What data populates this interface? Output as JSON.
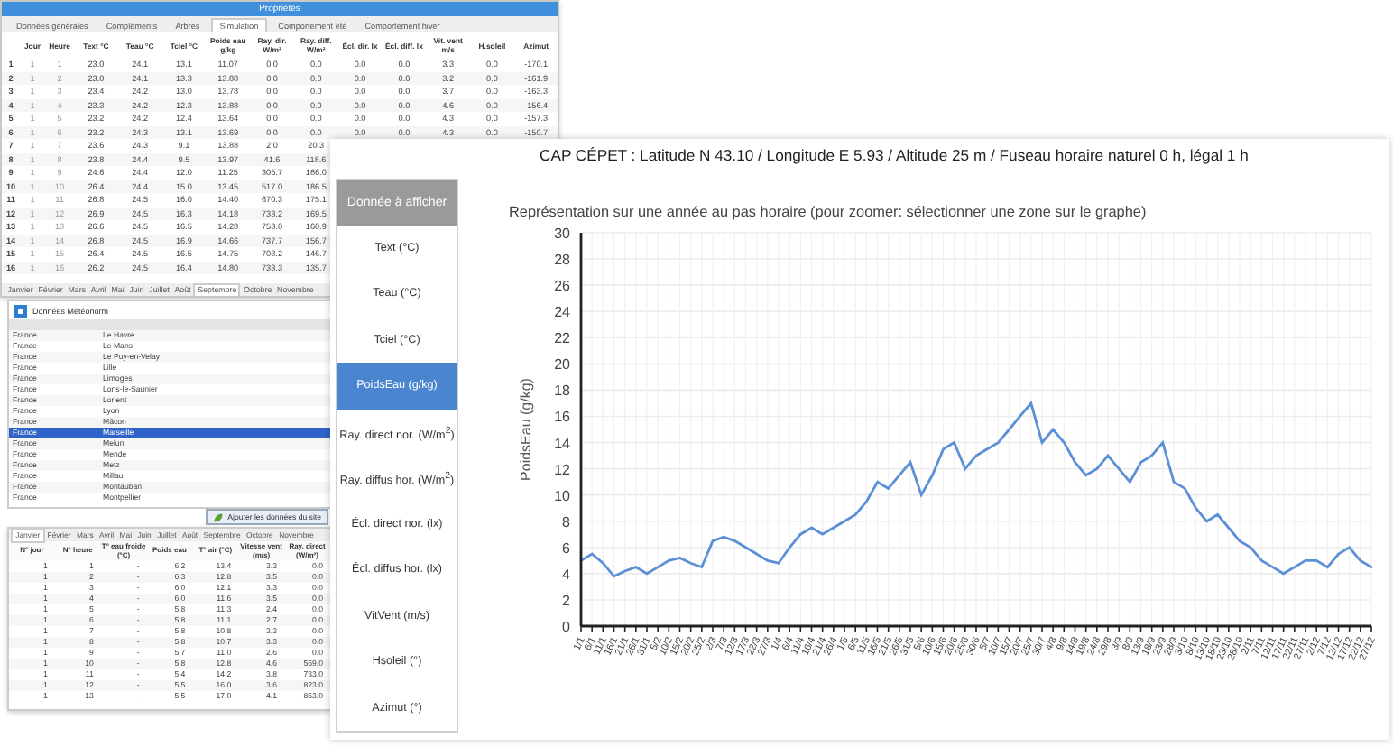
{
  "properties_window": {
    "title": "Propriétés",
    "tabs": [
      {
        "label": "Données générales",
        "selected": false
      },
      {
        "label": "Compléments",
        "selected": false
      },
      {
        "label": "Arbres",
        "selected": false
      },
      {
        "label": "Simulation",
        "selected": true
      },
      {
        "label": "Comportement été",
        "selected": false
      },
      {
        "label": "Comportement hiver",
        "selected": false
      }
    ],
    "table": {
      "columns": [
        "",
        "Jour",
        "Heure",
        "Text °C",
        "Teau °C",
        "Tciel °C",
        "Poids eau g/kg",
        "Ray. dir. W/m²",
        "Ray. diff. W/m²",
        "Écl. dir. lx",
        "Écl. diff. lx",
        "Vit. vent m/s",
        "H.soleil",
        "Azimut"
      ],
      "rows": [
        [
          "1",
          "1",
          "1",
          "23.0",
          "24.1",
          "13.1",
          "11.07",
          "0.0",
          "0.0",
          "0.0",
          "0.0",
          "3.3",
          "0.0",
          "-170.1"
        ],
        [
          "2",
          "1",
          "2",
          "23.0",
          "24.1",
          "13.3",
          "13.88",
          "0.0",
          "0.0",
          "0.0",
          "0.0",
          "3.2",
          "0.0",
          "-161.9"
        ],
        [
          "3",
          "1",
          "3",
          "23.4",
          "24.2",
          "13.0",
          "13.78",
          "0.0",
          "0.0",
          "0.0",
          "0.0",
          "3.7",
          "0.0",
          "-163.3"
        ],
        [
          "4",
          "1",
          "4",
          "23.3",
          "24.2",
          "12.3",
          "13.88",
          "0.0",
          "0.0",
          "0.0",
          "0.0",
          "4.6",
          "0.0",
          "-156.4"
        ],
        [
          "5",
          "1",
          "5",
          "23.2",
          "24.2",
          "12.4",
          "13.64",
          "0.0",
          "0.0",
          "0.0",
          "0.0",
          "4.3",
          "0.0",
          "-157.3"
        ],
        [
          "6",
          "1",
          "6",
          "23.2",
          "24.3",
          "13.1",
          "13.69",
          "0.0",
          "0.0",
          "0.0",
          "0.0",
          "4.3",
          "0.0",
          "-150.7"
        ],
        [
          "7",
          "1",
          "7",
          "23.6",
          "24.3",
          "9.1",
          "13.88",
          "2.0",
          "20.3"
        ],
        [
          "8",
          "1",
          "8",
          "23.8",
          "24.4",
          "9.5",
          "13.97",
          "41.6",
          "118.6"
        ],
        [
          "9",
          "1",
          "9",
          "24.6",
          "24.4",
          "12.0",
          "11.25",
          "305.7",
          "186.0"
        ],
        [
          "10",
          "1",
          "10",
          "26.4",
          "24.4",
          "15.0",
          "13.45",
          "517.0",
          "186.5"
        ],
        [
          "11",
          "1",
          "11",
          "26.8",
          "24.5",
          "16.0",
          "14.40",
          "670.3",
          "175.1"
        ],
        [
          "12",
          "1",
          "12",
          "26.9",
          "24.5",
          "16.3",
          "14.18",
          "733.2",
          "169.5"
        ],
        [
          "13",
          "1",
          "13",
          "26.6",
          "24.5",
          "16.5",
          "14.28",
          "753.0",
          "160.9"
        ],
        [
          "14",
          "1",
          "14",
          "26.8",
          "24.5",
          "16.9",
          "14.66",
          "737.7",
          "156.7"
        ],
        [
          "15",
          "1",
          "15",
          "26.4",
          "24.5",
          "16.5",
          "14.75",
          "703.2",
          "146.7"
        ],
        [
          "16",
          "1",
          "16",
          "26.2",
          "24.5",
          "16.4",
          "14.80",
          "733.3",
          "135.7"
        ]
      ]
    },
    "months": [
      {
        "label": "Janvier",
        "selected": false
      },
      {
        "label": "Février",
        "selected": false
      },
      {
        "label": "Mars",
        "selected": false
      },
      {
        "label": "Avril",
        "selected": false
      },
      {
        "label": "Mai",
        "selected": false
      },
      {
        "label": "Juin",
        "selected": false
      },
      {
        "label": "Juillet",
        "selected": false
      },
      {
        "label": "Août",
        "selected": false
      },
      {
        "label": "Septembre",
        "selected": true
      },
      {
        "label": "Octobre",
        "selected": false
      },
      {
        "label": "Novembre",
        "selected": false
      }
    ]
  },
  "meteonorm_window": {
    "title": "Données Météonorm",
    "stations": [
      {
        "country": "France",
        "city": "Le Havre",
        "selected": false
      },
      {
        "country": "France",
        "city": "Le Mans",
        "selected": false
      },
      {
        "country": "France",
        "city": "Le Puy-en-Velay",
        "selected": false
      },
      {
        "country": "France",
        "city": "Lille",
        "selected": false
      },
      {
        "country": "France",
        "city": "Limoges",
        "selected": false
      },
      {
        "country": "France",
        "city": "Lons-le-Saunier",
        "selected": false
      },
      {
        "country": "France",
        "city": "Lorient",
        "selected": false
      },
      {
        "country": "France",
        "city": "Lyon",
        "selected": false
      },
      {
        "country": "France",
        "city": "Mâcon",
        "selected": false
      },
      {
        "country": "France",
        "city": "Marseille",
        "selected": true
      },
      {
        "country": "France",
        "city": "Melun",
        "selected": false
      },
      {
        "country": "France",
        "city": "Mende",
        "selected": false
      },
      {
        "country": "France",
        "city": "Metz",
        "selected": false
      },
      {
        "country": "France",
        "city": "Millau",
        "selected": false
      },
      {
        "country": "France",
        "city": "Montauban",
        "selected": false
      },
      {
        "country": "France",
        "city": "Montpellier",
        "selected": false
      }
    ],
    "button": "Ajouter les données du site"
  },
  "hourly_window": {
    "months": [
      {
        "label": "Janvier",
        "selected": true
      },
      {
        "label": "Février",
        "selected": false
      },
      {
        "label": "Mars",
        "selected": false
      },
      {
        "label": "Avril",
        "selected": false
      },
      {
        "label": "Mai",
        "selected": false
      },
      {
        "label": "Juin",
        "selected": false
      },
      {
        "label": "Juillet",
        "selected": false
      },
      {
        "label": "Août",
        "selected": false
      },
      {
        "label": "Septembre",
        "selected": false
      },
      {
        "label": "Octobre",
        "selected": false
      },
      {
        "label": "Novembre",
        "selected": false
      }
    ],
    "columns": [
      "N° jour",
      "N° heure",
      "T° eau froide (°C)",
      "Poids eau",
      "T° air (°C)",
      "Vitesse vent (m/s)",
      "Ray. direct (W/m²)"
    ],
    "rows": [
      [
        "1",
        "1",
        "-",
        "6.2",
        "13.4",
        "3.3",
        "0.0"
      ],
      [
        "1",
        "2",
        "-",
        "6.3",
        "12.8",
        "3.5",
        "0.0"
      ],
      [
        "1",
        "3",
        "-",
        "6.0",
        "12.1",
        "3.3",
        "0.0"
      ],
      [
        "1",
        "4",
        "-",
        "6.0",
        "11.6",
        "3.5",
        "0.0"
      ],
      [
        "1",
        "5",
        "-",
        "5.8",
        "11.3",
        "2.4",
        "0.0"
      ],
      [
        "1",
        "6",
        "-",
        "5.8",
        "11.1",
        "2.7",
        "0.0"
      ],
      [
        "1",
        "7",
        "-",
        "5.8",
        "10.8",
        "3.3",
        "0.0"
      ],
      [
        "1",
        "8",
        "-",
        "5.8",
        "10.7",
        "3.3",
        "0.0"
      ],
      [
        "1",
        "9",
        "-",
        "5.7",
        "11.0",
        "2.6",
        "0.0"
      ],
      [
        "1",
        "10",
        "-",
        "5.8",
        "12.8",
        "4.6",
        "569.0"
      ],
      [
        "1",
        "11",
        "-",
        "5.4",
        "14.2",
        "3.8",
        "733.0"
      ],
      [
        "1",
        "12",
        "-",
        "5.5",
        "16.0",
        "3.6",
        "823.0"
      ],
      [
        "1",
        "13",
        "-",
        "5.5",
        "17.0",
        "4.1",
        "853.0"
      ]
    ]
  },
  "main_window": {
    "title": "CAP CÉPET : Latitude N 43.10 / Longitude E 5.93 / Altitude 25 m / Fuseau horaire naturel 0 h, légal 1 h",
    "menu": {
      "header": "Donnée à afficher",
      "items": [
        {
          "label": "Text (°C)",
          "selected": false
        },
        {
          "label": "Teau (°C)",
          "selected": false
        },
        {
          "label": "Tciel (°C)",
          "selected": false
        },
        {
          "label": "PoidsEau (g/kg)",
          "selected": true
        },
        {
          "label": "Ray. direct nor. (W/m$^{2}$)",
          "selected": false
        },
        {
          "label": "Ray. diffus hor. (W/m$^{2}$)",
          "selected": false
        },
        {
          "label": "Écl. direct nor. (lx)",
          "selected": false
        },
        {
          "label": "Écl. diffus hor. (lx)",
          "selected": false
        },
        {
          "label": "VitVent (m/s)",
          "selected": false
        },
        {
          "label": "Hsoleil (°)",
          "selected": false
        },
        {
          "label": "Azimut (°)",
          "selected": false
        }
      ]
    },
    "chart_subtitle": "Représentation sur une année au pas horaire (pour zoomer: sélectionner une zone sur le graphe)",
    "chart_data": {
      "type": "line",
      "ylabel": "PoidsEau (g/kg)",
      "ylim": [
        0,
        30
      ],
      "yticks": [
        0,
        2,
        4,
        6,
        8,
        10,
        12,
        14,
        16,
        18,
        20,
        22,
        24,
        26,
        28,
        30
      ],
      "x": [
        "1/1",
        "6/1",
        "11/1",
        "16/1",
        "21/1",
        "26/1",
        "31/1",
        "5/2",
        "10/2",
        "15/2",
        "20/2",
        "25/2",
        "2/3",
        "7/3",
        "12/3",
        "17/3",
        "22/3",
        "27/3",
        "1/4",
        "6/4",
        "11/4",
        "16/4",
        "21/4",
        "26/4",
        "1/5",
        "6/5",
        "11/5",
        "16/5",
        "21/5",
        "26/5",
        "31/5",
        "5/6",
        "10/6",
        "15/6",
        "20/6",
        "25/6",
        "30/6",
        "5/7",
        "10/7",
        "15/7",
        "20/7",
        "25/7",
        "30/7",
        "4/8",
        "9/8",
        "14/8",
        "19/8",
        "24/8",
        "29/8",
        "3/9",
        "8/9",
        "13/9",
        "18/9",
        "23/9",
        "28/9",
        "3/10",
        "8/10",
        "13/10",
        "18/10",
        "23/10",
        "28/10",
        "2/11",
        "7/11",
        "12/11",
        "17/11",
        "22/11",
        "27/11",
        "2/12",
        "7/12",
        "12/12",
        "17/12",
        "22/12",
        "27/12"
      ],
      "grid": true,
      "series": [
        {
          "color": "#5b8fd6",
          "values": [
            5.0,
            5.5,
            4.8,
            3.8,
            4.2,
            4.5,
            4.0,
            4.5,
            5.0,
            5.2,
            4.8,
            4.5,
            6.5,
            6.8,
            6.5,
            6.0,
            5.5,
            5.0,
            4.8,
            6.0,
            7.0,
            7.5,
            7.0,
            7.5,
            8.0,
            8.5,
            9.5,
            11.0,
            10.5,
            11.5,
            12.5,
            10.0,
            11.5,
            13.5,
            14.0,
            12.0,
            13.0,
            13.5,
            14.0,
            15.0,
            16.0,
            17.0,
            14.0,
            15.0,
            14.0,
            12.5,
            11.5,
            12.0,
            13.0,
            12.0,
            11.0,
            12.5,
            13.0,
            14.0,
            11.0,
            10.5,
            9.0,
            8.0,
            8.5,
            7.5,
            6.5,
            6.0,
            5.0,
            4.5,
            4.0,
            4.5,
            5.0,
            5.0,
            4.5,
            5.5,
            6.0,
            5.0,
            4.5
          ]
        }
      ]
    }
  }
}
